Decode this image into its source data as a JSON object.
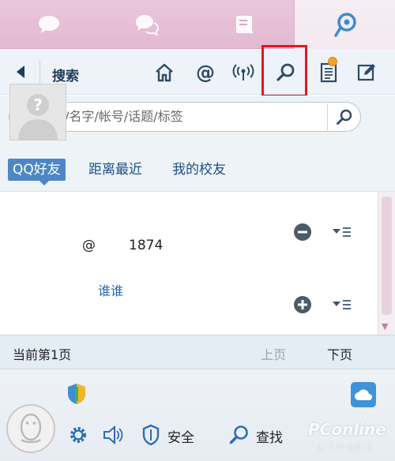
{
  "tabs": [
    {
      "icon": "chat-bubble-icon"
    },
    {
      "icon": "group-chat-icon"
    },
    {
      "icon": "contacts-icon"
    },
    {
      "icon": "weibo-icon",
      "active": true
    }
  ],
  "toolbar": {
    "title": "搜索",
    "icons": [
      "back-arrow-icon",
      "home-icon",
      "at-icon",
      "broadcast-icon",
      "search-icon",
      "notes-icon",
      "edit-icon"
    ]
  },
  "search": {
    "placeholder": "搜广播/名字/帐号/话题/标签"
  },
  "filters": [
    {
      "label": "QQ好友",
      "active": true
    },
    {
      "label": "距离最近",
      "active": false
    },
    {
      "label": "我的校友",
      "active": false
    }
  ],
  "list": [
    {
      "name": "",
      "handle_prefix": "@",
      "handle_suffix": "1874",
      "action": "remove"
    },
    {
      "name": "谁谁",
      "handle_prefix": "",
      "handle_suffix": "",
      "action": "add"
    }
  ],
  "pager": {
    "info": "当前第1页",
    "prev": "上页",
    "next": "下页"
  },
  "bottom": {
    "security_label": "安全",
    "find_label": "查找"
  },
  "watermark": {
    "brand": "PConline",
    "sub": "太平洋电脑网"
  },
  "colors": {
    "tab_bg": "#e3b9d1",
    "toolbar_bg": "#edf3f8",
    "link_blue": "#2867b2",
    "active_filter": "#4e86c6",
    "highlight_red": "#e0181c"
  }
}
